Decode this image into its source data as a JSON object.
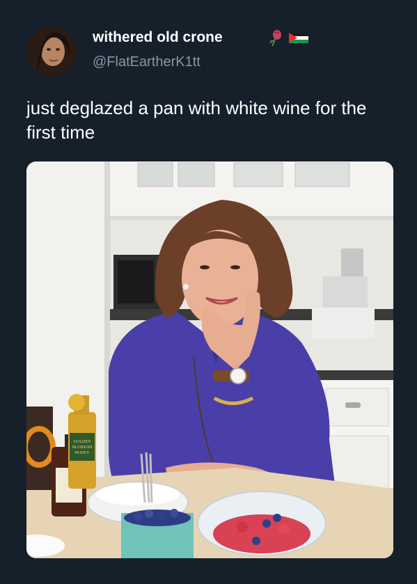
{
  "tweet": {
    "display_name": "withered old crone",
    "handle": "@FlatEartherK1tt",
    "text": "just deglazed a pan with white wine for the first time",
    "name_icons": [
      "rose-icon",
      "palestine-flag-icon"
    ]
  },
  "media": {
    "bottle_label_text": "GOLDEN BLOSSOM HONEY"
  },
  "colors": {
    "background": "#15202b",
    "handle": "#8899a6",
    "text": "#ffffff",
    "shirt": "#4a3fa8"
  }
}
